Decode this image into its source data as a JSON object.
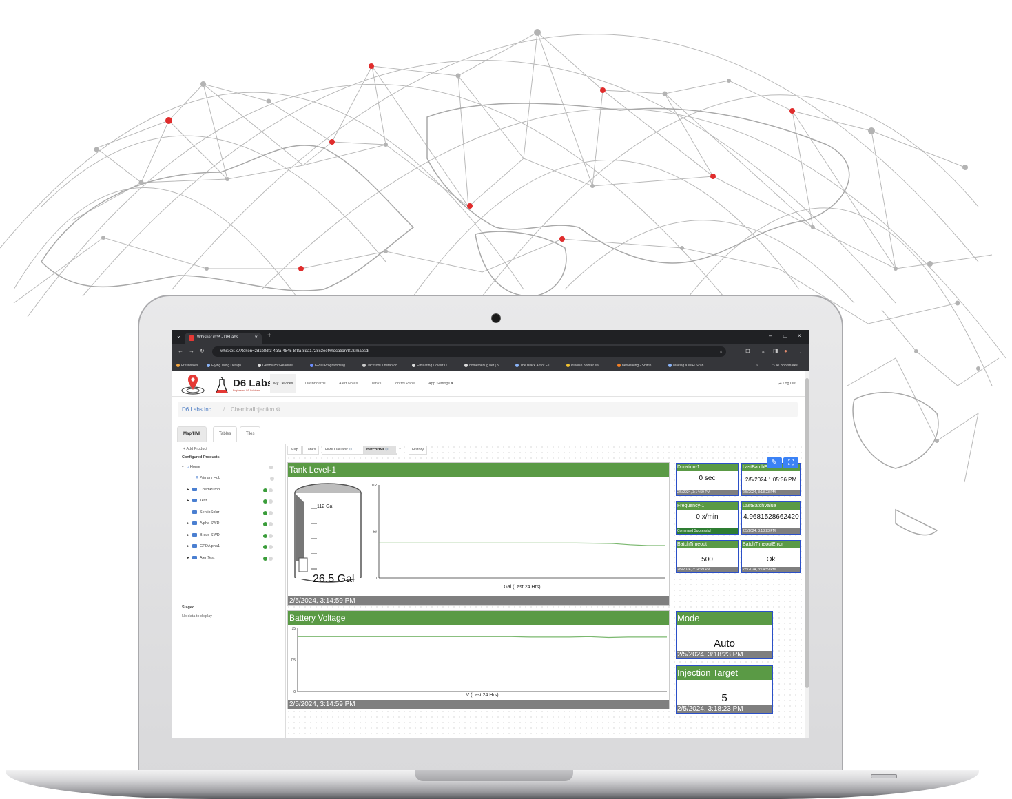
{
  "browser": {
    "tab_title": "Whisker.io™ - D6Labs",
    "tab_close": "×",
    "new_tab": "+",
    "window_controls": [
      "–",
      "▭",
      "×"
    ],
    "url": "whisker.io/?token=2d1b8df3-4afa-4845-8f8a-8da1728c3eef#/location/818/mapsdi",
    "nav_icons": [
      "arrow-left-icon",
      "arrow-right-icon",
      "reload-icon"
    ],
    "bookmarks": [
      "Freshsales",
      "Flying Wing Design...",
      "GeoBlazor/ReadMe...",
      "GPIO Programming...",
      "JacksonDunstan.co...",
      "Emulating Covert O...",
      "dotnetdebug.net | S...",
      "The Black Art of F/I...",
      "Pinoise pointer sal...",
      "networking - Sniffin...",
      "Making a WiFi Scan..."
    ],
    "bookmarks_more": "»",
    "all_bookmarks": "All Bookmarks"
  },
  "app": {
    "brand": "D6 Labs",
    "brand_sub": "Engineered IoT Solutions",
    "nav": [
      "My Devices",
      "Dashboards",
      "Alert Notes",
      "Tanks",
      "Control Panel",
      "App Settings ▾"
    ],
    "logout": "[➜ Log Out"
  },
  "breadcrumb": {
    "org": "D6 Labs Inc.",
    "sep": "/",
    "location": "ChemicalInjection ⚙"
  },
  "page_tabs": [
    "Map/HMI",
    "Tables",
    "Tiles"
  ],
  "sidebar": {
    "add_product": "+ Add Product",
    "configured": "Configured Products",
    "tree": [
      {
        "label": "Home",
        "caret": "▾",
        "status": "none"
      },
      {
        "label": "Primary Hub",
        "caret": "",
        "status": "grey"
      },
      {
        "label": "ChemPump",
        "caret": "▸",
        "status": "ok"
      },
      {
        "label": "Test",
        "caret": "▸",
        "status": "ok"
      },
      {
        "label": "SentioSolar",
        "caret": "",
        "status": "ok"
      },
      {
        "label": "Alpha SWD",
        "caret": "▸",
        "status": "ok"
      },
      {
        "label": "Bravo SWD",
        "caret": "▸",
        "status": "ok"
      },
      {
        "label": "GPDAlpha1",
        "caret": "▸",
        "status": "ok"
      },
      {
        "label": "AlertTest",
        "caret": "▸",
        "status": "ok"
      }
    ],
    "staged": "Staged",
    "no_data": "No data to display"
  },
  "sub_tabs": [
    "Map",
    "Tanks",
    "HMIDualTank",
    "BatchHMI",
    "+",
    "History"
  ],
  "tank_panel": {
    "title": "Tank Level-1",
    "capacity_label": "112 Gal",
    "level_label": "26.5 Gal",
    "footer": "2/5/2024, 3:14:59 PM"
  },
  "battery_panel": {
    "title": "Battery Voltage",
    "footer": "2/5/2024, 3:14:59 PM"
  },
  "tiles": [
    {
      "title": "Duration-1",
      "value": "0 sec",
      "footer": "2/5/2024, 3:14:59 PM",
      "ok": false
    },
    {
      "title": "LastBatchEnd",
      "value": "2/5/2024 1:05:36 PM",
      "footer": "2/5/2024, 3:18:23 PM",
      "ok": false
    },
    {
      "title": "Frequency-1",
      "value": "0 x/min",
      "footer": "Command Successful",
      "ok": true
    },
    {
      "title": "LastBatchValue",
      "value": "4.9681528662420",
      "footer": "2/5/2024, 3:18:23 PM",
      "ok": false
    },
    {
      "title": "BatchTimeout",
      "value": "500",
      "footer": "2/5/2024, 3:14:59 PM",
      "ok": false
    },
    {
      "title": "BatchTimeoutError",
      "value": "Ok",
      "footer": "2/5/2024, 3:14:59 PM",
      "ok": false
    }
  ],
  "big_tiles": [
    {
      "title": "Mode",
      "value": "Auto",
      "footer": "2/5/2024, 3:18:23 PM"
    },
    {
      "title": "Injection Target",
      "value": "5",
      "footer": "2/5/2024, 3:18:23 PM"
    }
  ],
  "tools": {
    "wrench": "wrench-icon",
    "fullscreen": "fullscreen-icon"
  },
  "chart_data": [
    {
      "type": "line",
      "xlabel": "Gal (Last 24 Hrs)",
      "ylabel": "",
      "ylim": [
        0,
        112
      ],
      "yticks": [
        0,
        56,
        112
      ],
      "series": [
        {
          "values": [
            42,
            42,
            42,
            42,
            42,
            42,
            42,
            42,
            42,
            42,
            42,
            42,
            41.8,
            41.5,
            40,
            39,
            39
          ]
        }
      ],
      "color": "#7bb86f",
      "grid": false
    },
    {
      "type": "line",
      "xlabel": "V (Last 24 Hrs)",
      "ylabel": "",
      "ylim": [
        0,
        15
      ],
      "yticks": [
        0,
        7.5,
        15
      ],
      "series": [
        {
          "values": [
            13.0,
            13.0,
            13.0,
            13.0,
            13.0,
            13.0,
            13.0,
            13.0,
            13.0,
            13.0,
            13.0,
            13.0,
            12.9,
            12.9,
            12.9,
            13.0,
            12.8,
            12.9,
            12.9,
            12.9
          ]
        }
      ],
      "color": "#7bb86f",
      "grid": false
    }
  ]
}
